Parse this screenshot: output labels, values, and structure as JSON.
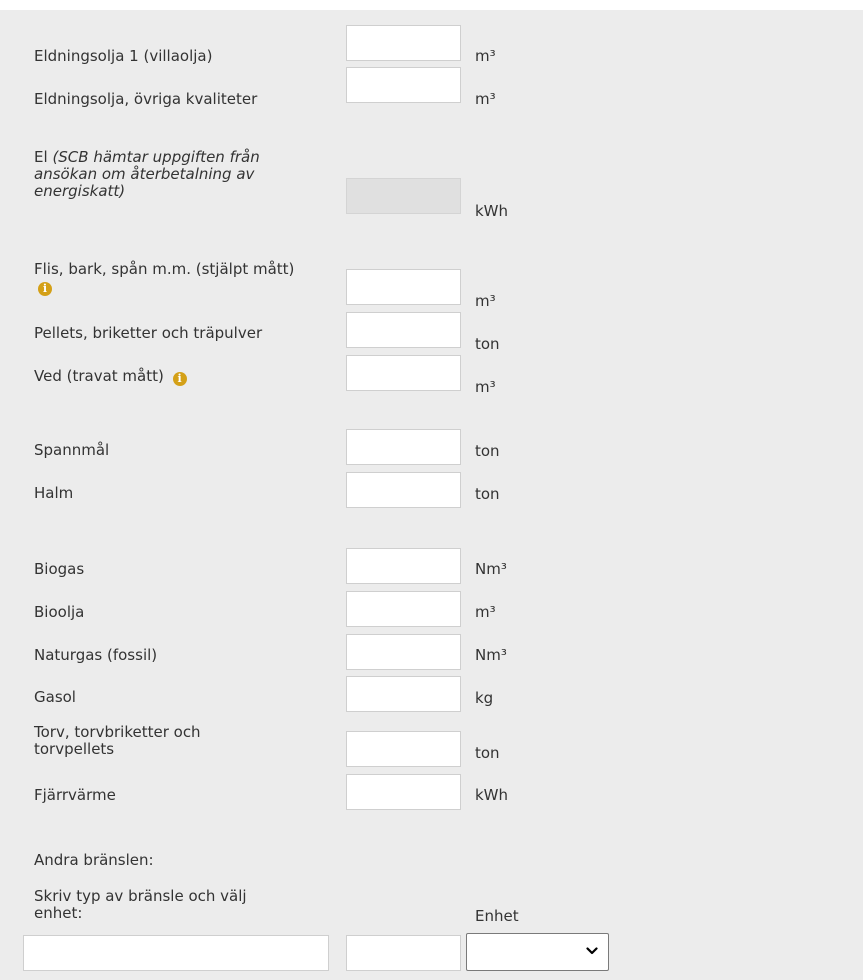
{
  "fuels": [
    {
      "label": "Eldningsolja 1 (villaolja)",
      "unit": "m³",
      "value": ""
    },
    {
      "label": "Eldningsolja, övriga kvaliteter",
      "unit": "m³",
      "value": ""
    },
    {
      "label": "El",
      "note": "(SCB hämtar uppgiften från ansökan om återbetalning av energiskatt)",
      "unit": "kWh",
      "value": "",
      "disabled": true
    },
    {
      "label": "Flis, bark, spån m.m. (stjälpt mått)",
      "unit": "m³",
      "value": "",
      "info": true
    },
    {
      "label": "Pellets, briketter och träpulver",
      "unit": "ton",
      "value": ""
    },
    {
      "label": "Ved (travat mått)",
      "unit": "m³",
      "value": "",
      "info": true
    },
    {
      "label": "Spannmål",
      "unit": "ton",
      "value": ""
    },
    {
      "label": "Halm",
      "unit": "ton",
      "value": ""
    },
    {
      "label": "Biogas",
      "unit": "Nm³",
      "value": ""
    },
    {
      "label": "Bioolja",
      "unit": "m³",
      "value": ""
    },
    {
      "label": "Naturgas (fossil)",
      "unit": "Nm³",
      "value": ""
    },
    {
      "label": "Gasol",
      "unit": "kg",
      "value": ""
    },
    {
      "label": "Torv, torvbriketter och torvpellets",
      "unit": "ton",
      "value": ""
    },
    {
      "label": "Fjärrvärme",
      "unit": "kWh",
      "value": ""
    }
  ],
  "other": {
    "heading": "Andra bränslen:",
    "instruction": "Skriv typ av bränsle och välj enhet:",
    "unit_heading": "Enhet",
    "type_value": "",
    "amount_value": "",
    "unit_selected": ""
  },
  "icons": {
    "info": "info-circle-icon",
    "dropdown": "chevron-down-icon"
  },
  "colors": {
    "panel": "#ececec",
    "info_icon": "#d4a017",
    "disabled_field": "#e0e0e0"
  }
}
